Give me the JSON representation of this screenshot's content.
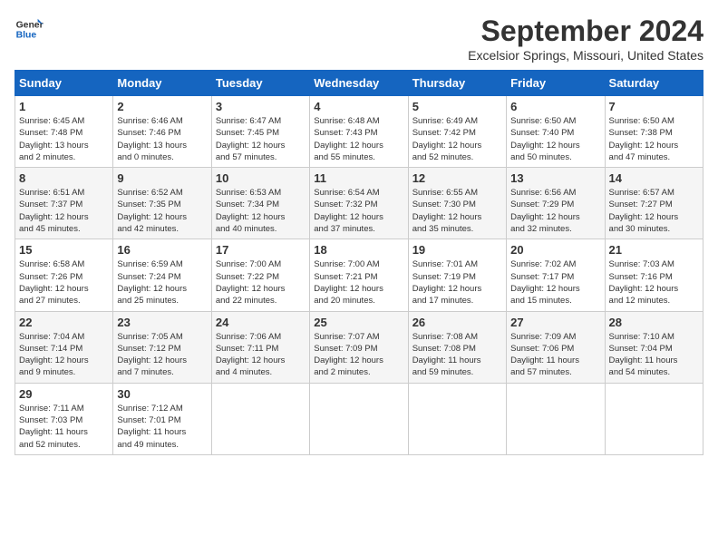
{
  "header": {
    "logo_line1": "General",
    "logo_line2": "Blue",
    "month_year": "September 2024",
    "location": "Excelsior Springs, Missouri, United States"
  },
  "days_of_week": [
    "Sunday",
    "Monday",
    "Tuesday",
    "Wednesday",
    "Thursday",
    "Friday",
    "Saturday"
  ],
  "weeks": [
    [
      {
        "day": "1",
        "info": "Sunrise: 6:45 AM\nSunset: 7:48 PM\nDaylight: 13 hours\nand 2 minutes."
      },
      {
        "day": "2",
        "info": "Sunrise: 6:46 AM\nSunset: 7:46 PM\nDaylight: 13 hours\nand 0 minutes."
      },
      {
        "day": "3",
        "info": "Sunrise: 6:47 AM\nSunset: 7:45 PM\nDaylight: 12 hours\nand 57 minutes."
      },
      {
        "day": "4",
        "info": "Sunrise: 6:48 AM\nSunset: 7:43 PM\nDaylight: 12 hours\nand 55 minutes."
      },
      {
        "day": "5",
        "info": "Sunrise: 6:49 AM\nSunset: 7:42 PM\nDaylight: 12 hours\nand 52 minutes."
      },
      {
        "day": "6",
        "info": "Sunrise: 6:50 AM\nSunset: 7:40 PM\nDaylight: 12 hours\nand 50 minutes."
      },
      {
        "day": "7",
        "info": "Sunrise: 6:50 AM\nSunset: 7:38 PM\nDaylight: 12 hours\nand 47 minutes."
      }
    ],
    [
      {
        "day": "8",
        "info": "Sunrise: 6:51 AM\nSunset: 7:37 PM\nDaylight: 12 hours\nand 45 minutes."
      },
      {
        "day": "9",
        "info": "Sunrise: 6:52 AM\nSunset: 7:35 PM\nDaylight: 12 hours\nand 42 minutes."
      },
      {
        "day": "10",
        "info": "Sunrise: 6:53 AM\nSunset: 7:34 PM\nDaylight: 12 hours\nand 40 minutes."
      },
      {
        "day": "11",
        "info": "Sunrise: 6:54 AM\nSunset: 7:32 PM\nDaylight: 12 hours\nand 37 minutes."
      },
      {
        "day": "12",
        "info": "Sunrise: 6:55 AM\nSunset: 7:30 PM\nDaylight: 12 hours\nand 35 minutes."
      },
      {
        "day": "13",
        "info": "Sunrise: 6:56 AM\nSunset: 7:29 PM\nDaylight: 12 hours\nand 32 minutes."
      },
      {
        "day": "14",
        "info": "Sunrise: 6:57 AM\nSunset: 7:27 PM\nDaylight: 12 hours\nand 30 minutes."
      }
    ],
    [
      {
        "day": "15",
        "info": "Sunrise: 6:58 AM\nSunset: 7:26 PM\nDaylight: 12 hours\nand 27 minutes."
      },
      {
        "day": "16",
        "info": "Sunrise: 6:59 AM\nSunset: 7:24 PM\nDaylight: 12 hours\nand 25 minutes."
      },
      {
        "day": "17",
        "info": "Sunrise: 7:00 AM\nSunset: 7:22 PM\nDaylight: 12 hours\nand 22 minutes."
      },
      {
        "day": "18",
        "info": "Sunrise: 7:00 AM\nSunset: 7:21 PM\nDaylight: 12 hours\nand 20 minutes."
      },
      {
        "day": "19",
        "info": "Sunrise: 7:01 AM\nSunset: 7:19 PM\nDaylight: 12 hours\nand 17 minutes."
      },
      {
        "day": "20",
        "info": "Sunrise: 7:02 AM\nSunset: 7:17 PM\nDaylight: 12 hours\nand 15 minutes."
      },
      {
        "day": "21",
        "info": "Sunrise: 7:03 AM\nSunset: 7:16 PM\nDaylight: 12 hours\nand 12 minutes."
      }
    ],
    [
      {
        "day": "22",
        "info": "Sunrise: 7:04 AM\nSunset: 7:14 PM\nDaylight: 12 hours\nand 9 minutes."
      },
      {
        "day": "23",
        "info": "Sunrise: 7:05 AM\nSunset: 7:12 PM\nDaylight: 12 hours\nand 7 minutes."
      },
      {
        "day": "24",
        "info": "Sunrise: 7:06 AM\nSunset: 7:11 PM\nDaylight: 12 hours\nand 4 minutes."
      },
      {
        "day": "25",
        "info": "Sunrise: 7:07 AM\nSunset: 7:09 PM\nDaylight: 12 hours\nand 2 minutes."
      },
      {
        "day": "26",
        "info": "Sunrise: 7:08 AM\nSunset: 7:08 PM\nDaylight: 11 hours\nand 59 minutes."
      },
      {
        "day": "27",
        "info": "Sunrise: 7:09 AM\nSunset: 7:06 PM\nDaylight: 11 hours\nand 57 minutes."
      },
      {
        "day": "28",
        "info": "Sunrise: 7:10 AM\nSunset: 7:04 PM\nDaylight: 11 hours\nand 54 minutes."
      }
    ],
    [
      {
        "day": "29",
        "info": "Sunrise: 7:11 AM\nSunset: 7:03 PM\nDaylight: 11 hours\nand 52 minutes."
      },
      {
        "day": "30",
        "info": "Sunrise: 7:12 AM\nSunset: 7:01 PM\nDaylight: 11 hours\nand 49 minutes."
      },
      {
        "day": "",
        "info": ""
      },
      {
        "day": "",
        "info": ""
      },
      {
        "day": "",
        "info": ""
      },
      {
        "day": "",
        "info": ""
      },
      {
        "day": "",
        "info": ""
      }
    ]
  ]
}
